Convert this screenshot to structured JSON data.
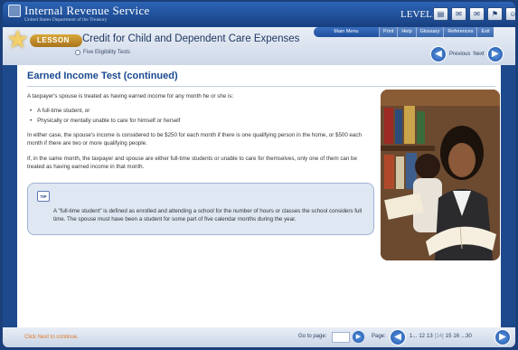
{
  "app": {
    "title": "Internal Revenue Service",
    "subtitle": "United States Department of the Treasury",
    "level_label": "LEVEL:",
    "level_icons": [
      "certificate-icon",
      "mail-icon",
      "mail-icon",
      "bookmark-icon",
      "people-icon"
    ]
  },
  "header": {
    "lesson_label": "LESSON",
    "lesson_title": "Credit for Child and Dependent Care Expenses",
    "subtopic": "Five Eligibility Tests"
  },
  "menu": {
    "main": "Main Menu",
    "items": [
      "Print",
      "Help",
      "Glossary",
      "References",
      "Exit"
    ]
  },
  "nav": {
    "previous": "Previous",
    "next": "Next"
  },
  "content": {
    "heading": "Earned Income Test (continued)",
    "intro": "A taxpayer's spouse is treated as having earned income for any month he or she is:",
    "bullets": [
      "A full-time student, or",
      "Physically or mentally unable to care for himself or herself"
    ],
    "para1": "In either case, the spouse's income is considered to be $250 for each month if there is one qualifying person in the home, or $500 each month if there are two or more qualifying people.",
    "para2": "If, in the same month, the taxpayer and spouse are either full-time students or unable to care for themselves, only one of them can be treated as having earned income in that month.",
    "tip_label": "TIP",
    "tip_text": "A \"full-time student\" is defined as enrolled and attending a school for the number of hours or classes the school considers full time. The spouse must have been a student for some part of five calendar months during the year."
  },
  "footer": {
    "click_next": "Click Next to continue.",
    "go_to_page": "Go to page:",
    "page_label": "Page:",
    "pages": [
      "1...",
      "12",
      "13",
      "[14]",
      "15",
      "16",
      "...30"
    ]
  }
}
